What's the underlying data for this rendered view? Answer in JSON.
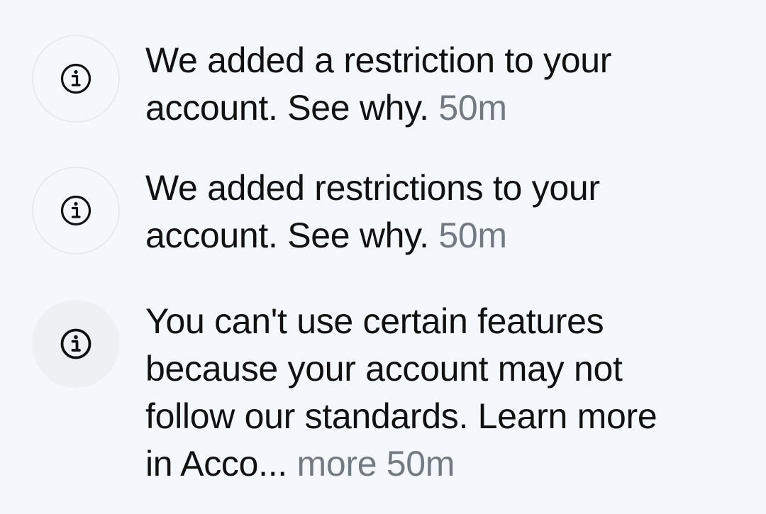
{
  "notifications": [
    {
      "icon": "info-icon",
      "message_line1": "We added a restriction to your",
      "message_line2": "account. See why.",
      "time": "50m"
    },
    {
      "icon": "info-icon",
      "message_line1": "We added restrictions to your",
      "message_line2": "account. See why.",
      "time": "50m"
    },
    {
      "icon": "info-icon",
      "message_line1": "You can't use certain features",
      "message_line2": "because your account may not",
      "message_line3": "follow our standards. Learn more",
      "message_line4": "in Acco...",
      "more_label": "more",
      "time": "50m"
    }
  ],
  "colors": {
    "background": "#f4f8fc",
    "text": "#111111",
    "muted_text": "#737a82",
    "icon_stroke": "#111111"
  }
}
